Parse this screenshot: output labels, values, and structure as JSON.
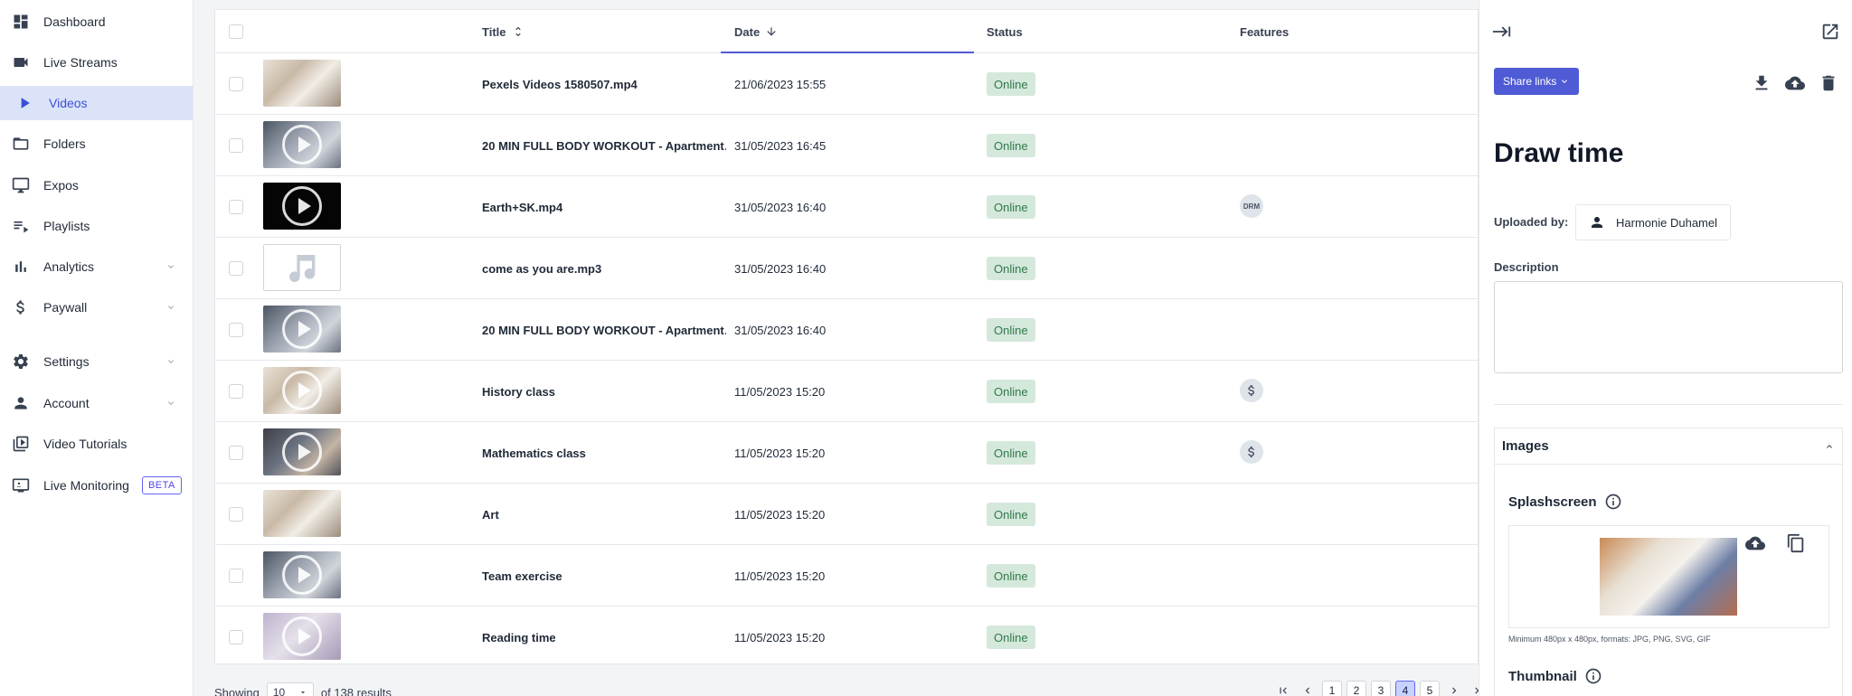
{
  "sidebar": {
    "items": [
      {
        "label": "Dashboard",
        "icon": "dashboard-icon"
      },
      {
        "label": "Live Streams",
        "icon": "videocam-icon"
      },
      {
        "label": "Videos",
        "icon": "play-icon"
      },
      {
        "label": "Folders",
        "icon": "folder-icon"
      },
      {
        "label": "Expos",
        "icon": "monitor-icon"
      },
      {
        "label": "Playlists",
        "icon": "playlist-icon"
      },
      {
        "label": "Analytics",
        "icon": "bar-chart-icon"
      },
      {
        "label": "Paywall",
        "icon": "dollar-icon"
      },
      {
        "label": "Settings",
        "icon": "gear-icon"
      },
      {
        "label": "Account",
        "icon": "person-icon"
      },
      {
        "label": "Video Tutorials",
        "icon": "video-library-icon"
      },
      {
        "label": "Live Monitoring",
        "icon": "live-monitor-icon"
      }
    ],
    "beta_badge": "BETA"
  },
  "table": {
    "headers": {
      "title": "Title",
      "date": "Date",
      "status": "Status",
      "features": "Features"
    },
    "rows": [
      {
        "title": "Pexels Videos 1580507.mp4",
        "date": "21/06/2023 15:55",
        "status": "Online",
        "feature": ""
      },
      {
        "title": "20 MIN FULL BODY WORKOUT - Apartment…",
        "date": "31/05/2023 16:45",
        "status": "Online",
        "feature": ""
      },
      {
        "title": "Earth+SK.mp4",
        "date": "31/05/2023 16:40",
        "status": "Online",
        "feature": "DRM"
      },
      {
        "title": "come as you are.mp3",
        "date": "31/05/2023 16:40",
        "status": "Online",
        "feature": ""
      },
      {
        "title": "20 MIN FULL BODY WORKOUT - Apartment…",
        "date": "31/05/2023 16:40",
        "status": "Online",
        "feature": ""
      },
      {
        "title": "History class",
        "date": "11/05/2023 15:20",
        "status": "Online",
        "feature": "dollar-icon"
      },
      {
        "title": "Mathematics class",
        "date": "11/05/2023 15:20",
        "status": "Online",
        "feature": "dollar-icon"
      },
      {
        "title": "Art",
        "date": "11/05/2023 15:20",
        "status": "Online",
        "feature": ""
      },
      {
        "title": "Team exercise",
        "date": "11/05/2023 15:20",
        "status": "Online",
        "feature": ""
      },
      {
        "title": "Reading time",
        "date": "11/05/2023 15:20",
        "status": "Online",
        "feature": ""
      }
    ]
  },
  "pagination": {
    "showing_label": "Showing",
    "per_page": "10",
    "total_label": "of 138 results",
    "pages": [
      "1",
      "2",
      "3",
      "4",
      "5"
    ],
    "current_page": "4"
  },
  "panel": {
    "share_label": "Share links",
    "title": "Draw time",
    "uploaded_by_label": "Uploaded by:",
    "uploader": "Harmonie Duhamel",
    "description_label": "Description",
    "description_value": "",
    "images_label": "Images",
    "splashscreen_label": "Splashscreen",
    "splash_hint": "Minimum 480px x 480px, formats: JPG, PNG, SVG, GIF",
    "thumbnail_label": "Thumbnail"
  },
  "colors": {
    "accent": "#4f5bd5",
    "active_nav_bg": "#dbe3f8",
    "status_bg": "#d5e8dc",
    "status_text": "#2f7a48"
  }
}
